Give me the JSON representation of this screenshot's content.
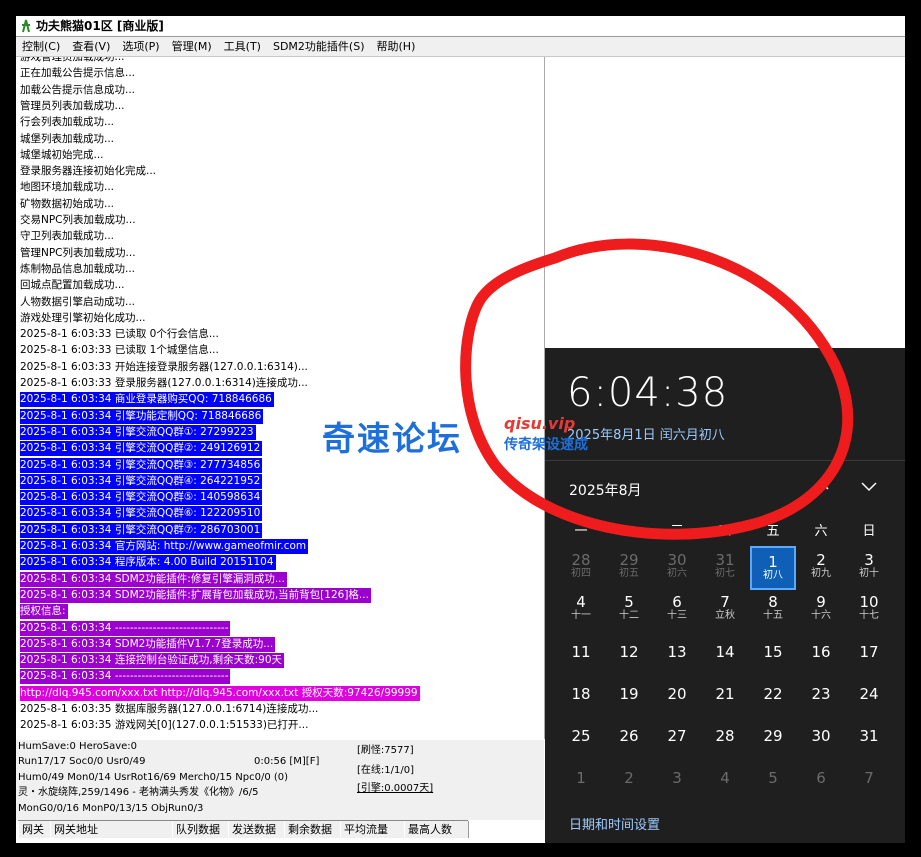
{
  "window": {
    "title": "功夫熊猫01区 [商业版]"
  },
  "menu": [
    "控制(C)",
    "查看(V)",
    "选项(P)",
    "管理(M)",
    "工具(T)",
    "SDM2功能插件(S)",
    "帮助(H)"
  ],
  "log": [
    {
      "text": "游戏管理员加载成功...",
      "style": "plain"
    },
    {
      "text": "正在加载公告提示信息...",
      "style": "plain"
    },
    {
      "text": "加载公告提示信息成功...",
      "style": "plain"
    },
    {
      "text": "管理员列表加载成功...",
      "style": "plain"
    },
    {
      "text": "行会列表加载成功...",
      "style": "plain"
    },
    {
      "text": "城堡列表加载成功...",
      "style": "plain"
    },
    {
      "text": "城堡城初始完成...",
      "style": "plain"
    },
    {
      "text": "登录服务器连接初始化完成...",
      "style": "plain"
    },
    {
      "text": "地图环境加载成功...",
      "style": "plain"
    },
    {
      "text": "矿物数据初始成功...",
      "style": "plain"
    },
    {
      "text": "交易NPC列表加载成功...",
      "style": "plain"
    },
    {
      "text": "守卫列表加载成功...",
      "style": "plain"
    },
    {
      "text": "管理NPC列表加载成功...",
      "style": "plain"
    },
    {
      "text": "炼制物品信息加载成功...",
      "style": "plain"
    },
    {
      "text": "回城点配置加载成功...",
      "style": "plain"
    },
    {
      "text": "人物数据引擎启动成功...",
      "style": "plain"
    },
    {
      "text": "游戏处理引擎初始化成功...",
      "style": "plain"
    },
    {
      "text": "2025-8-1 6:03:33 已读取 0个行会信息...",
      "style": "plain"
    },
    {
      "text": "2025-8-1 6:03:33 已读取 1个城堡信息...",
      "style": "plain"
    },
    {
      "text": "2025-8-1 6:03:33 开始连接登录服务器(127.0.0.1:6314)...",
      "style": "plain"
    },
    {
      "text": "2025-8-1 6:03:33 登录服务器(127.0.0.1:6314)连接成功...",
      "style": "plain"
    },
    {
      "text": "2025-8-1 6:03:34 商业登录器购买QQ: 718846686",
      "style": "blue"
    },
    {
      "text": "2025-8-1 6:03:34 引擎功能定制QQ: 718846686",
      "style": "blue"
    },
    {
      "text": "2025-8-1 6:03:34 引擎交流QQ群①: 27299223",
      "style": "blue"
    },
    {
      "text": "2025-8-1 6:03:34 引擎交流QQ群②: 249126912",
      "style": "blue"
    },
    {
      "text": "2025-8-1 6:03:34 引擎交流QQ群③: 277734856",
      "style": "blue"
    },
    {
      "text": "2025-8-1 6:03:34 引擎交流QQ群④: 264221952",
      "style": "blue"
    },
    {
      "text": "2025-8-1 6:03:34 引擎交流QQ群⑤: 140598634",
      "style": "blue"
    },
    {
      "text": "2025-8-1 6:03:34 引擎交流QQ群⑥: 122209510",
      "style": "blue"
    },
    {
      "text": "2025-8-1 6:03:34 引擎交流QQ群⑦: 286703001",
      "style": "blue"
    },
    {
      "text": "2025-8-1 6:03:34 官方网站: http://www.gameofmir.com",
      "style": "blue"
    },
    {
      "text": "2025-8-1 6:03:34 程序版本: 4.00 Build 20151104",
      "style": "blue"
    },
    {
      "text": "2025-8-1 6:03:34 SDM2功能插件:修复引擎漏洞成功...",
      "style": "purple"
    },
    {
      "text": "2025-8-1 6:03:34 SDM2功能插件:扩展背包加载成功,当前背包[126]格...",
      "style": "purple"
    },
    {
      "text": "授权信息:",
      "style": "purple"
    },
    {
      "text": "2025-8-1 6:03:34 ------------------------------",
      "style": "purple"
    },
    {
      "text": "2025-8-1 6:03:34 SDM2功能插件V1.7.7登录成功...",
      "style": "purple"
    },
    {
      "text": "2025-8-1 6:03:34 连接控制台验证成功,剩余天数:90天",
      "style": "purple"
    },
    {
      "text": "2025-8-1 6:03:34 ------------------------------",
      "style": "purple"
    },
    {
      "text": "http://dlq.945.com/xxx.txt http://dlq.945.com/xxx.txt 授权天数:97426/99999",
      "style": "magenta"
    },
    {
      "text": "2025-8-1 6:03:35 数据库服务器(127.0.0.1:6714)连接成功...",
      "style": "plain"
    },
    {
      "text": "2025-8-1 6:03:35 游戏网关[0](127.0.0.1:51533)已打开...",
      "style": "plain"
    }
  ],
  "status": {
    "l1": "HumSave:0 HeroSave:0",
    "l2": "Run17/17 Soc0/0 Usr0/49",
    "l2b": "0:0:56 [M][F]",
    "l3": "Hum0/49 Mon0/14 UsrRot16/69 Merch0/15 Npc0/0 (0)",
    "l4": "灵・水旋绕阵,259/1496 - 老衲满头秀发《化物》/6/5",
    "l5": "MonG0/0/16 MonP0/13/15 ObjRun0/3",
    "r1": "[刷怪:7577]",
    "r2": "[在线:1/1/0]",
    "r3": "[引擎:0.0007天]"
  },
  "table_headers": [
    "网关",
    "网关地址",
    "队列数据",
    "发送数据",
    "剩余数据",
    "平均流量",
    "最高人数"
  ],
  "watermark": {
    "main": "奇速论坛",
    "url": "qisu.vip",
    "sub": "传奇架设速成"
  },
  "calendar": {
    "time": "6:04:38",
    "date": "2025年8月1日 闰六月初八",
    "month": "2025年8月",
    "weekdays": [
      "一",
      "二",
      "三",
      "四",
      "五",
      "六",
      "日"
    ],
    "days": [
      {
        "n": "28",
        "l": "初四",
        "other": true
      },
      {
        "n": "29",
        "l": "初五",
        "other": true
      },
      {
        "n": "30",
        "l": "初六",
        "other": true
      },
      {
        "n": "31",
        "l": "初七",
        "other": true
      },
      {
        "n": "1",
        "l": "初八",
        "today": true
      },
      {
        "n": "2",
        "l": "初九"
      },
      {
        "n": "3",
        "l": "初十"
      },
      {
        "n": "4",
        "l": "十一"
      },
      {
        "n": "5",
        "l": "十二"
      },
      {
        "n": "6",
        "l": "十三"
      },
      {
        "n": "7",
        "l": "立秋"
      },
      {
        "n": "8",
        "l": "十五"
      },
      {
        "n": "9",
        "l": "十六"
      },
      {
        "n": "10",
        "l": "十七"
      },
      {
        "n": "11",
        "l": ""
      },
      {
        "n": "12",
        "l": ""
      },
      {
        "n": "13",
        "l": ""
      },
      {
        "n": "14",
        "l": ""
      },
      {
        "n": "15",
        "l": ""
      },
      {
        "n": "16",
        "l": ""
      },
      {
        "n": "17",
        "l": ""
      },
      {
        "n": "18",
        "l": ""
      },
      {
        "n": "19",
        "l": ""
      },
      {
        "n": "20",
        "l": ""
      },
      {
        "n": "21",
        "l": ""
      },
      {
        "n": "22",
        "l": ""
      },
      {
        "n": "23",
        "l": ""
      },
      {
        "n": "24",
        "l": ""
      },
      {
        "n": "25",
        "l": ""
      },
      {
        "n": "26",
        "l": ""
      },
      {
        "n": "27",
        "l": ""
      },
      {
        "n": "28",
        "l": ""
      },
      {
        "n": "29",
        "l": ""
      },
      {
        "n": "30",
        "l": ""
      },
      {
        "n": "31",
        "l": ""
      },
      {
        "n": "1",
        "l": "",
        "other": true
      },
      {
        "n": "2",
        "l": "",
        "other": true
      },
      {
        "n": "3",
        "l": "",
        "other": true
      },
      {
        "n": "4",
        "l": "",
        "other": true
      },
      {
        "n": "5",
        "l": "",
        "other": true
      },
      {
        "n": "6",
        "l": "",
        "other": true
      },
      {
        "n": "7",
        "l": "",
        "other": true
      }
    ],
    "settings": "日期和时间设置"
  },
  "colors": {
    "blue_hl": "#0000ff",
    "purple_hl": "#9b00cf",
    "magenta_hl": "#e000e0",
    "annotation": "#ee1c1c"
  }
}
